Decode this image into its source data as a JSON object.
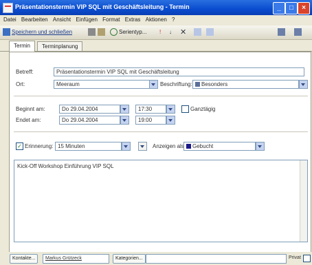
{
  "window": {
    "title": "Präsentationstermin VIP SQL mit Geschäftsleitung - Termin",
    "min": "_",
    "max": "□",
    "close": "×"
  },
  "menu": [
    "Datei",
    "Bearbeiten",
    "Ansicht",
    "Einfügen",
    "Format",
    "Extras",
    "Aktionen",
    "?"
  ],
  "toolbar": {
    "save_close": "Speichern und schließen",
    "recurrence": "Serientyp..."
  },
  "tabs": [
    "Termin",
    "Terminplanung"
  ],
  "form": {
    "subject_label": "Betreff:",
    "subject_value": "Präsentationstermin VIP SQL mit Geschäftsleitung",
    "location_label": "Ort:",
    "location_value": "Meeraum",
    "label_label": "Beschriftung:",
    "label_value": "Besonders",
    "label_color": "#5b6f9a",
    "start_label": "Beginnt am:",
    "start_date": "Do 29.04.2004",
    "start_time": "17:30",
    "allday_label": "Ganztägig",
    "end_label": "Endet am:",
    "end_date": "Do 29.04.2004",
    "end_time": "19:00",
    "reminder_label": "Erinnerung:",
    "reminder_value": "15 Minuten",
    "reminder_checked": "✓",
    "showas_label": "Anzeigen als:",
    "showas_value": "Gebucht",
    "showas_color": "#1a1a8a",
    "notes": "Kick-Off Workshop Einführung VIP SQL"
  },
  "bottom": {
    "contacts_button": "Kontakte...",
    "contact_value": "Markus Grützeck",
    "categories_button": "Kategorien...",
    "private_label": "Privat"
  }
}
